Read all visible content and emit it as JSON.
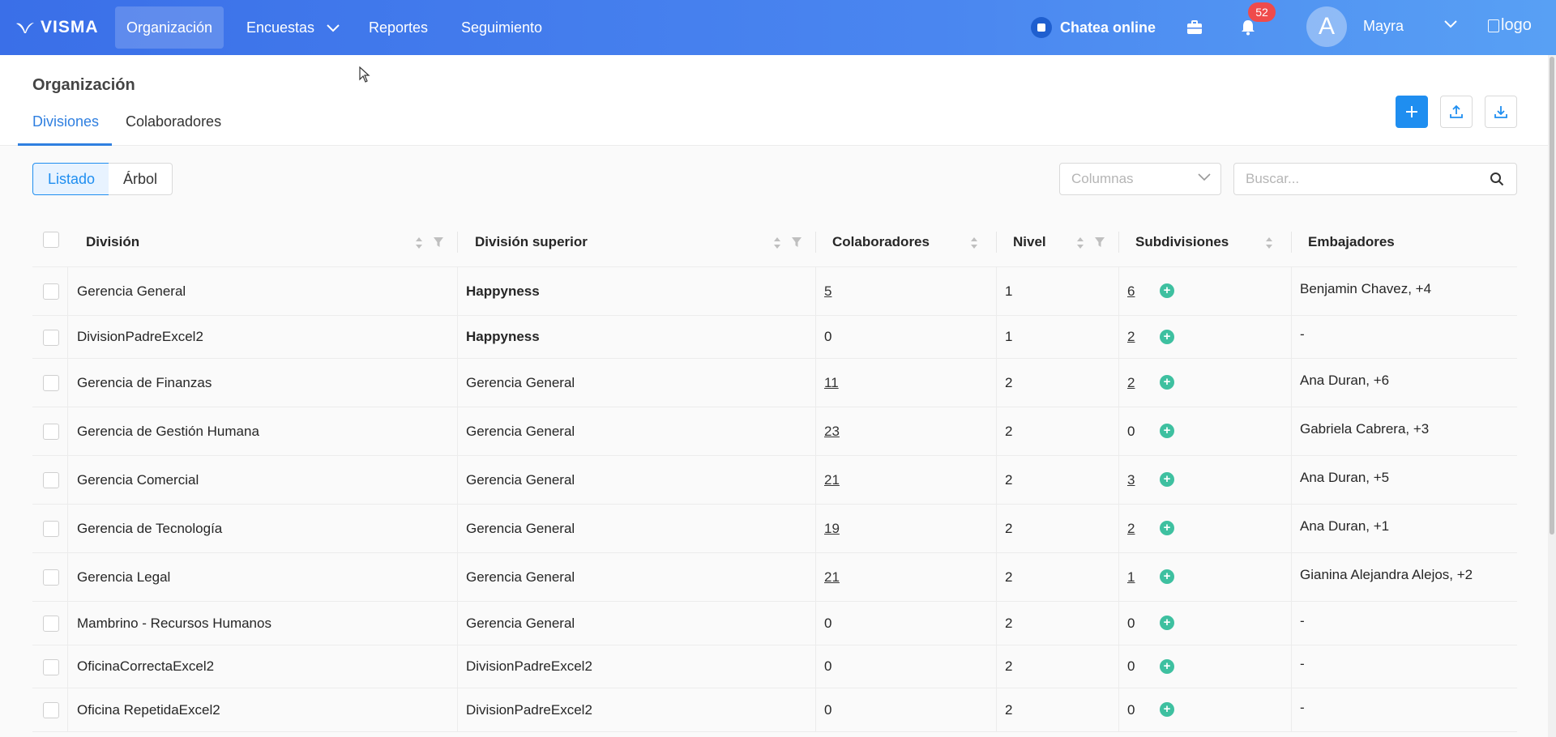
{
  "topbar": {
    "brand": "VISMA",
    "nav": [
      {
        "label": "Organización",
        "active": true
      },
      {
        "label": "Encuestas",
        "has_dropdown": true
      },
      {
        "label": "Reportes"
      },
      {
        "label": "Seguimiento"
      }
    ],
    "chat_label": "Chatea online",
    "notifications_count": "52",
    "avatar_letter": "A",
    "user_name": "Mayra",
    "logo_alt": "logo"
  },
  "header": {
    "title": "Organización",
    "tabs": [
      {
        "label": "Divisiones",
        "active": true
      },
      {
        "label": "Colaboradores"
      }
    ]
  },
  "toolbar": {
    "view_options": [
      {
        "label": "Listado",
        "active": true
      },
      {
        "label": "Árbol"
      }
    ],
    "columns_placeholder": "Columnas",
    "search_placeholder": "Buscar..."
  },
  "table": {
    "columns": [
      "División",
      "División superior",
      "Colaboradores",
      "Nivel",
      "Subdivisiones",
      "Embajadores"
    ],
    "rows": [
      {
        "division": "Gerencia General",
        "superior": "Happyness",
        "superior_bold": true,
        "colaboradores": "5",
        "col_link": true,
        "nivel": "1",
        "subdivisiones": "6",
        "sub_link": true,
        "embajadores": "Benjamin Chavez, +4"
      },
      {
        "division": "DivisionPadreExcel2",
        "superior": "Happyness",
        "superior_bold": true,
        "colaboradores": "0",
        "col_link": false,
        "nivel": "1",
        "subdivisiones": "2",
        "sub_link": true,
        "embajadores": "-"
      },
      {
        "division": "Gerencia de Finanzas",
        "superior": "Gerencia General",
        "superior_bold": false,
        "colaboradores": "11",
        "col_link": true,
        "nivel": "2",
        "subdivisiones": "2",
        "sub_link": true,
        "embajadores": "Ana Duran, +6"
      },
      {
        "division": "Gerencia de Gestión Humana",
        "superior": "Gerencia General",
        "superior_bold": false,
        "colaboradores": "23",
        "col_link": true,
        "nivel": "2",
        "subdivisiones": "0",
        "sub_link": false,
        "embajadores": "Gabriela Cabrera, +3"
      },
      {
        "division": "Gerencia Comercial",
        "superior": "Gerencia General",
        "superior_bold": false,
        "colaboradores": "21",
        "col_link": true,
        "nivel": "2",
        "subdivisiones": "3",
        "sub_link": true,
        "embajadores": "Ana Duran, +5"
      },
      {
        "division": "Gerencia de Tecnología",
        "superior": "Gerencia General",
        "superior_bold": false,
        "colaboradores": "19",
        "col_link": true,
        "nivel": "2",
        "subdivisiones": "2",
        "sub_link": true,
        "embajadores": "Ana Duran, +1"
      },
      {
        "division": "Gerencia Legal",
        "superior": "Gerencia General",
        "superior_bold": false,
        "colaboradores": "21",
        "col_link": true,
        "nivel": "2",
        "subdivisiones": "1",
        "sub_link": true,
        "embajadores": "Gianina Alejandra Alejos, +2"
      },
      {
        "division": "Mambrino - Recursos Humanos",
        "superior": "Gerencia General",
        "superior_bold": false,
        "colaboradores": "0",
        "col_link": false,
        "nivel": "2",
        "subdivisiones": "0",
        "sub_link": false,
        "embajadores": "-"
      },
      {
        "division": "OficinaCorrectaExcel2",
        "superior": "DivisionPadreExcel2",
        "superior_bold": false,
        "colaboradores": "0",
        "col_link": false,
        "nivel": "2",
        "subdivisiones": "0",
        "sub_link": false,
        "embajadores": "-"
      },
      {
        "division": "Oficina RepetidaExcel2",
        "superior": "DivisionPadreExcel2",
        "superior_bold": false,
        "colaboradores": "0",
        "col_link": false,
        "nivel": "2",
        "subdivisiones": "0",
        "sub_link": false,
        "embajadores": "-"
      }
    ]
  },
  "colors": {
    "accent": "#1f8ef0",
    "topbar_start": "#3a6fe8",
    "topbar_end": "#58a0f4",
    "add_green": "#3ec0a0",
    "badge": "#ef4b4b"
  }
}
